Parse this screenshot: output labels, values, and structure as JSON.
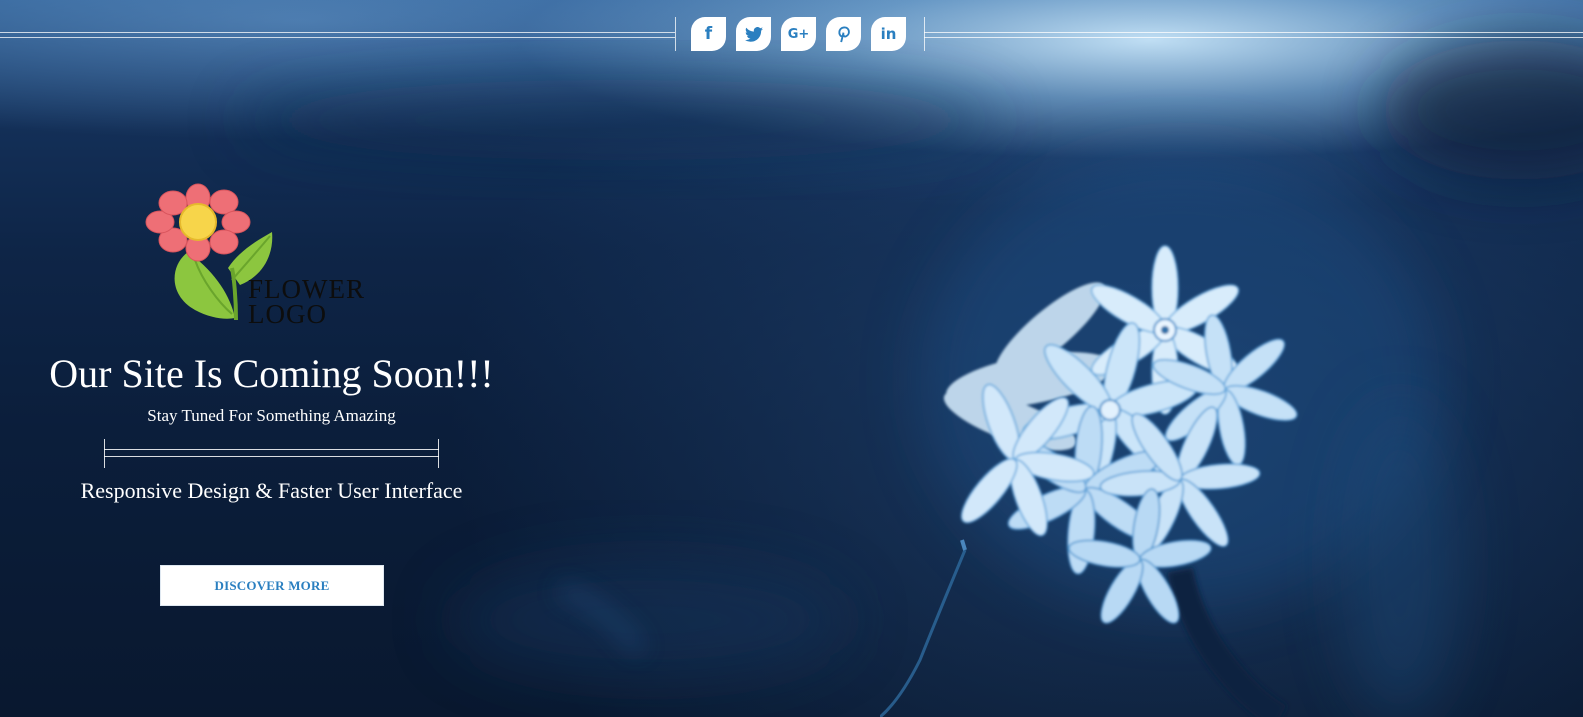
{
  "social": {
    "items": [
      {
        "name": "facebook",
        "icon": "facebook-icon",
        "glyph": "f"
      },
      {
        "name": "twitter",
        "icon": "twitter-icon",
        "glyph": ""
      },
      {
        "name": "google-plus",
        "icon": "google-plus-icon",
        "glyph": "G+"
      },
      {
        "name": "pinterest",
        "icon": "pinterest-icon",
        "glyph": ""
      },
      {
        "name": "linkedin",
        "icon": "linkedin-icon",
        "glyph": "in"
      }
    ],
    "icon_color": "#2a7fc0"
  },
  "logo": {
    "line1": "FLOWER",
    "line2": "LOGO",
    "petal_color": "#ee6f76",
    "center_color": "#f7d54a",
    "leaf_color": "#8cc63f"
  },
  "hero": {
    "headline": "Our Site Is Coming Soon!!!",
    "subline": "Stay Tuned For Something Amazing",
    "tagline": "Responsive Design & Faster User Interface",
    "cta_label": "DISCOVER MORE"
  },
  "theme": {
    "accent": "#2a7fc0",
    "background": "#0b1d38",
    "flower_color": "#9fd0f5"
  }
}
